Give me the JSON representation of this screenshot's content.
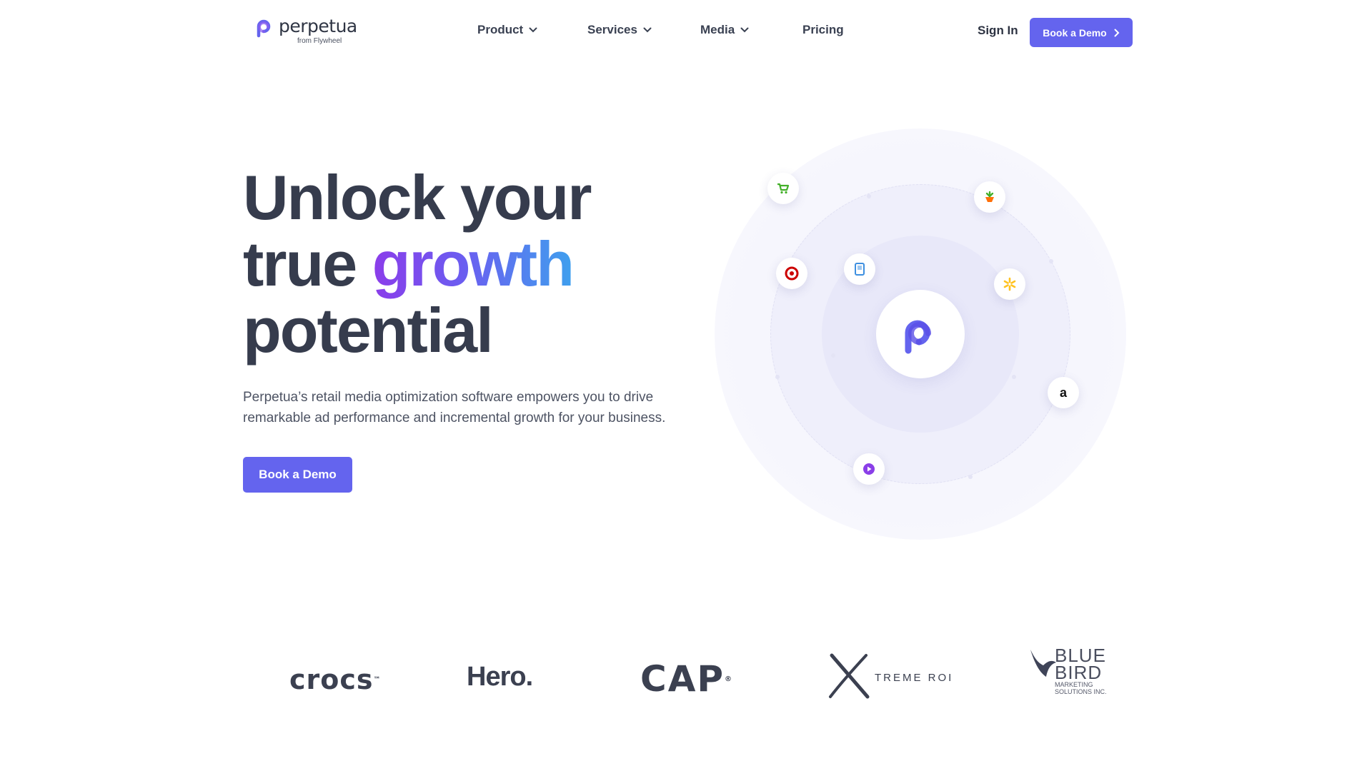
{
  "brand": {
    "name": "perpetua",
    "sub": "from Flywheel",
    "accent": "#6464ee"
  },
  "nav": {
    "items": [
      {
        "label": "Product",
        "has_dropdown": true
      },
      {
        "label": "Services",
        "has_dropdown": true
      },
      {
        "label": "Media",
        "has_dropdown": true
      },
      {
        "label": "Pricing",
        "has_dropdown": false
      }
    ],
    "sign_in": "Sign In",
    "cta": "Book a Demo"
  },
  "hero": {
    "title_line1": "Unlock your",
    "title_line2_a": "true ",
    "title_line2_b": "growth",
    "title_line3": "potential",
    "subtitle": "Perpetua’s retail media optimization software empowers you to drive remarkable ad performance and incremental growth for your business.",
    "cta": "Book a Demo"
  },
  "orbit": {
    "center_icon": "perpetua-logo-icon",
    "nodes": [
      {
        "name": "instacart-cart-icon",
        "color": "#43b02a"
      },
      {
        "name": "instacart-carrot-icon",
        "color": "#43b02a"
      },
      {
        "name": "target-icon",
        "color": "#cc0000"
      },
      {
        "name": "tablet-icon",
        "color": "#3d8fe0"
      },
      {
        "name": "walmart-spark-icon",
        "color": "#ffc220"
      },
      {
        "name": "amazon-icon",
        "glyph": "a",
        "color": "#111111"
      },
      {
        "name": "play-icon",
        "color": "#8a3ee8"
      }
    ]
  },
  "brands": {
    "crocs": "crocs",
    "crocs_mark": "™",
    "hero": "Hero.",
    "cap": "CAP",
    "cap_mark": "®",
    "xtreme": "TREME ROI",
    "bluebird_big1": "BLUE",
    "bluebird_big2": "BIRD",
    "bluebird_small1": "MARKETING",
    "bluebird_small2": "SOLUTIONS INC."
  }
}
